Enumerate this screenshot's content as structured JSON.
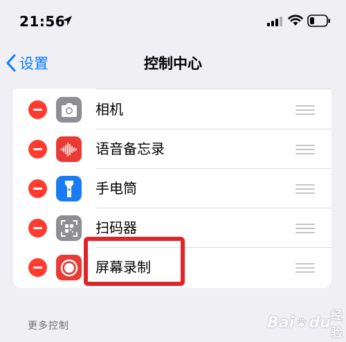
{
  "status_bar": {
    "time": "21:56"
  },
  "nav": {
    "back_label": "设置",
    "title": "控制中心"
  },
  "controls": [
    {
      "label": "相机",
      "icon": "camera-icon",
      "icon_color": "#8e8e93"
    },
    {
      "label": "语音备忘录",
      "icon": "waveform-icon",
      "icon_color": "#e93a35"
    },
    {
      "label": "手电筒",
      "icon": "flashlight-icon",
      "icon_color": "#1a7cf5"
    },
    {
      "label": "扫码器",
      "icon": "qr-code-icon",
      "icon_color": "#8e8e93"
    },
    {
      "label": "屏幕录制",
      "icon": "screen-record-icon",
      "icon_color": "#e93a35"
    }
  ],
  "more_controls_header": "更多控制",
  "watermark": {
    "brand": "Bai",
    "brand_suffix": "du",
    "site": "经验"
  },
  "colors": {
    "accent": "#0a7aff",
    "remove": "#ff3b30",
    "highlight": "#e0242a"
  }
}
